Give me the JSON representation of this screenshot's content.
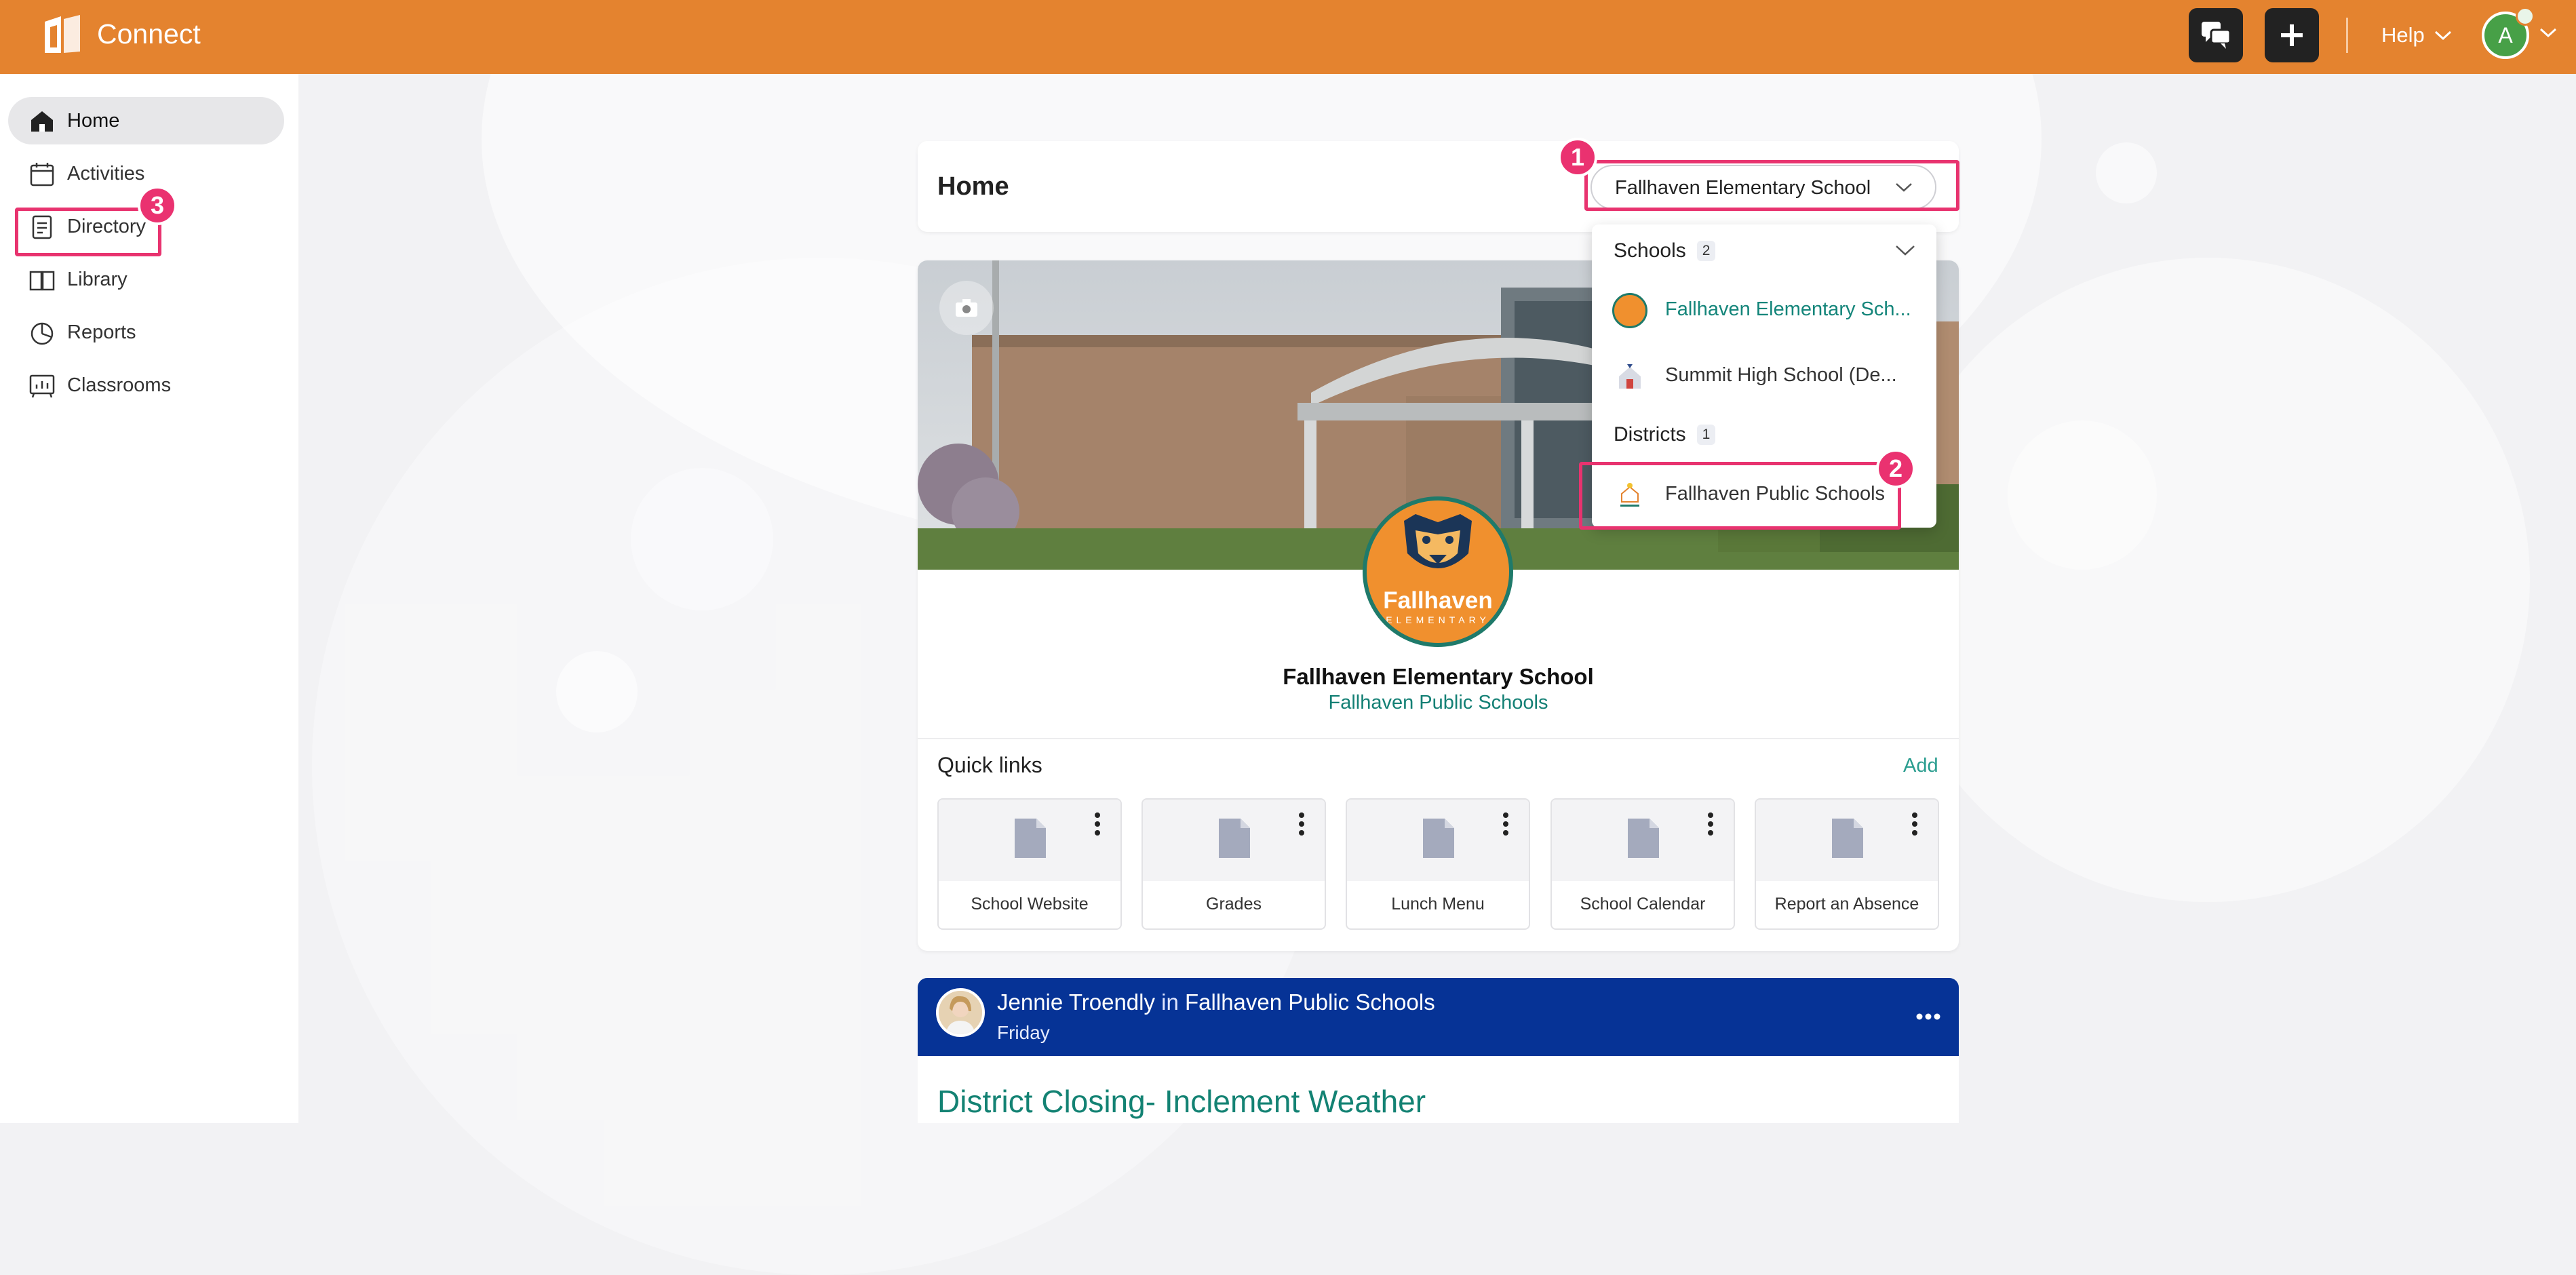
{
  "app": {
    "name": "Connect",
    "brand_color": "#e4832f"
  },
  "topbar": {
    "chat_icon": "chat-bubbles-icon",
    "add_icon": "plus-icon",
    "help_label": "Help",
    "avatar_initial": "A"
  },
  "sidebar": {
    "items": [
      {
        "label": "Home",
        "icon": "home-icon",
        "active": true
      },
      {
        "label": "Activities",
        "icon": "calendar-icon"
      },
      {
        "label": "Directory",
        "icon": "directory-icon"
      },
      {
        "label": "Library",
        "icon": "book-icon"
      },
      {
        "label": "Reports",
        "icon": "pie-chart-icon"
      },
      {
        "label": "Classrooms",
        "icon": "classroom-icon"
      }
    ]
  },
  "annotations": {
    "badge1": "1",
    "badge2": "2",
    "badge3": "3",
    "highlight_color": "#e8336f"
  },
  "header": {
    "title": "Home",
    "selected_school": "Fallhaven Elementary School"
  },
  "dropdown": {
    "schools_label": "Schools",
    "schools_count": "2",
    "schools": [
      {
        "label": "Fallhaven Elementary Sch...",
        "selected": true
      },
      {
        "label": "Summit High School (De..."
      }
    ],
    "districts_label": "Districts",
    "districts_count": "1",
    "districts": [
      {
        "label": "Fallhaven Public Schools"
      }
    ]
  },
  "profile": {
    "logo_name": "Fallhaven",
    "logo_sub": "ELEMENTARY",
    "school_name": "Fallhaven Elementary School",
    "district": "Fallhaven Public Schools"
  },
  "quick_links": {
    "title": "Quick links",
    "add_label": "Add",
    "items": [
      {
        "label": "School Website"
      },
      {
        "label": "Grades"
      },
      {
        "label": "Lunch Menu"
      },
      {
        "label": "School Calendar"
      },
      {
        "label": "Report an Absence"
      }
    ]
  },
  "post": {
    "author": "Jennie Troendly",
    "in_word": "in",
    "group": "Fallhaven Public Schools",
    "day": "Friday",
    "title": "District Closing- Inclement Weather",
    "header_color": "#063396"
  }
}
